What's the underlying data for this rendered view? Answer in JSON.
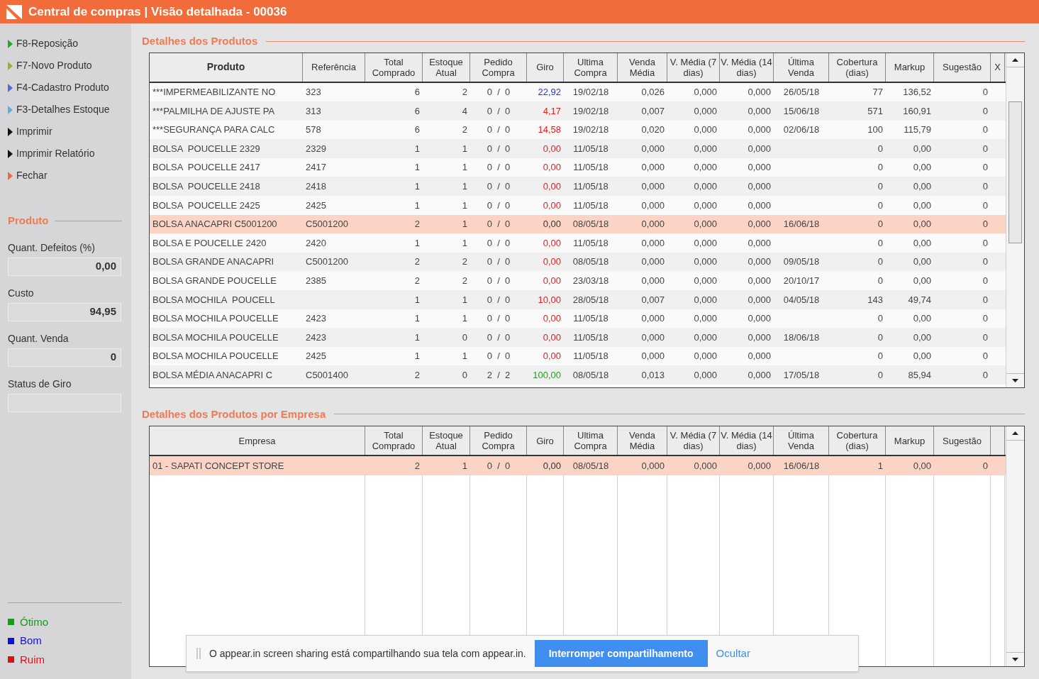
{
  "window": {
    "title": "Central de compras | Visão detalhada - 00036"
  },
  "sidebar": {
    "actions": [
      {
        "label": "F8-Reposição",
        "color": "#1fa82a"
      },
      {
        "label": "F7-Novo Produto",
        "color": "#8fb33a"
      },
      {
        "label": "F4-Cadastro Produto",
        "color": "#4a6fe0"
      },
      {
        "label": "F3-Detalhes Estoque",
        "color": "#5aaee0"
      },
      {
        "label": "Imprimir",
        "color": "#111111"
      },
      {
        "label": "Imprimir Relatório",
        "color": "#111111"
      },
      {
        "label": "Fechar",
        "color": "#f26b3a"
      }
    ],
    "section_title": "Produto",
    "fields": [
      {
        "label": "Quant. Defeitos (%)",
        "value": "0,00"
      },
      {
        "label": "Custo",
        "value": "94,95"
      },
      {
        "label": "Quant. Venda",
        "value": "0"
      },
      {
        "label": "Status de Giro"
      }
    ],
    "legend": [
      {
        "label": "Ótimo",
        "color": "#12a012"
      },
      {
        "label": "Bom",
        "color": "#1010e0"
      },
      {
        "label": "Ruim",
        "color": "#e01010"
      }
    ]
  },
  "products": {
    "title": "Detalhes dos Produtos",
    "columns": [
      "Produto",
      "Referência",
      "Total Comprado",
      "Estoque Atual",
      "Pedido Compra",
      "Giro",
      "Ultima Compra",
      "Venda Média",
      "V. Média (7 dias)",
      "V. Média (14 dias)",
      "Última Venda",
      "Cobertura (dias)",
      "Markup",
      "Sugestão",
      "X"
    ],
    "rows": [
      {
        "produto": "***IMPERMEABILIZANTE NO",
        "referencia": "323",
        "total": "6",
        "estoque": "2",
        "pedido": "0  /  0",
        "giro": "22,92",
        "color": "#2233dd",
        "ultima_compra": "19/02/18",
        "venda_media": "0,026",
        "vm7": "0,000",
        "vm14": "0,000",
        "ultima_venda": "26/05/18",
        "cobertura": "77",
        "markup": "136,52",
        "sugestao": "0",
        "selected": false
      },
      {
        "produto": "***PALMILHA DE AJUSTE PA",
        "referencia": "313",
        "total": "6",
        "estoque": "4",
        "pedido": "0  /  0",
        "giro": "4,17",
        "color": "#e02020",
        "ultima_compra": "19/02/18",
        "venda_media": "0,007",
        "vm7": "0,000",
        "vm14": "0,000",
        "ultima_venda": "15/06/18",
        "cobertura": "571",
        "markup": "160,91",
        "sugestao": "0",
        "selected": false
      },
      {
        "produto": "***SEGURANÇA PARA CALC",
        "referencia": "578",
        "total": "6",
        "estoque": "2",
        "pedido": "0  /  0",
        "giro": "14,58",
        "color": "#e02020",
        "ultima_compra": "19/02/18",
        "venda_media": "0,020",
        "vm7": "0,000",
        "vm14": "0,000",
        "ultima_venda": "02/06/18",
        "cobertura": "100",
        "markup": "115,79",
        "sugestao": "0",
        "selected": false
      },
      {
        "produto": "BOLSA  POUCELLE 2329",
        "referencia": "2329",
        "total": "1",
        "estoque": "1",
        "pedido": "0  /  0",
        "giro": "0,00",
        "color": "#e02020",
        "ultima_compra": "11/05/18",
        "venda_media": "0,000",
        "vm7": "0,000",
        "vm14": "0,000",
        "cobertura": "0",
        "markup": "0,00",
        "sugestao": "0",
        "selected": false
      },
      {
        "produto": "BOLSA  POUCELLE 2417",
        "referencia": "2417",
        "total": "1",
        "estoque": "1",
        "pedido": "0  /  0",
        "giro": "0,00",
        "color": "#e02020",
        "ultima_compra": "11/05/18",
        "venda_media": "0,000",
        "vm7": "0,000",
        "vm14": "0,000",
        "cobertura": "0",
        "markup": "0,00",
        "sugestao": "0",
        "selected": false
      },
      {
        "produto": "BOLSA  POUCELLE 2418",
        "referencia": "2418",
        "total": "1",
        "estoque": "1",
        "pedido": "0  /  0",
        "giro": "0,00",
        "color": "#e02020",
        "ultima_compra": "11/05/18",
        "venda_media": "0,000",
        "vm7": "0,000",
        "vm14": "0,000",
        "cobertura": "0",
        "markup": "0,00",
        "sugestao": "0",
        "selected": false
      },
      {
        "produto": "BOLSA  POUCELLE 2425",
        "referencia": "2425",
        "total": "1",
        "estoque": "1",
        "pedido": "0  /  0",
        "giro": "0,00",
        "color": "#e02020",
        "ultima_compra": "11/05/18",
        "venda_media": "0,000",
        "vm7": "0,000",
        "vm14": "0,000",
        "cobertura": "0",
        "markup": "0,00",
        "sugestao": "0",
        "selected": false
      },
      {
        "produto": "BOLSA ANACAPRI C5001200",
        "referencia": "C5001200",
        "total": "2",
        "estoque": "1",
        "pedido": "0  /  0",
        "giro": "0,00",
        "color": "#333333",
        "ultima_compra": "08/05/18",
        "venda_media": "0,000",
        "vm7": "0,000",
        "vm14": "0,000",
        "ultima_venda": "16/06/18",
        "cobertura": "0",
        "markup": "0,00",
        "sugestao": "0",
        "selected": true
      },
      {
        "produto": "BOLSA E POUCELLE 2420",
        "referencia": "2420",
        "total": "1",
        "estoque": "1",
        "pedido": "0  /  0",
        "giro": "0,00",
        "color": "#e02020",
        "ultima_compra": "11/05/18",
        "venda_media": "0,000",
        "vm7": "0,000",
        "vm14": "0,000",
        "cobertura": "0",
        "markup": "0,00",
        "sugestao": "0",
        "selected": false
      },
      {
        "produto": "BOLSA GRANDE ANACAPRI",
        "referencia": "C5001200",
        "total": "2",
        "estoque": "2",
        "pedido": "0  /  0",
        "giro": "0,00",
        "color": "#e02020",
        "ultima_compra": "08/05/18",
        "venda_media": "0,000",
        "vm7": "0,000",
        "vm14": "0,000",
        "ultima_venda": "09/05/18",
        "cobertura": "0",
        "markup": "0,00",
        "sugestao": "0",
        "selected": false
      },
      {
        "produto": "BOLSA GRANDE POUCELLE",
        "referencia": "2385",
        "total": "2",
        "estoque": "2",
        "pedido": "0  /  0",
        "giro": "0,00",
        "color": "#e02020",
        "ultima_compra": "23/03/18",
        "venda_media": "0,000",
        "vm7": "0,000",
        "vm14": "0,000",
        "ultima_venda": "20/10/17",
        "cobertura": "0",
        "markup": "0,00",
        "sugestao": "0",
        "selected": false
      },
      {
        "produto": "BOLSA MOCHILA  POUCELL",
        "total": "1",
        "estoque": "1",
        "pedido": "0  /  0",
        "giro": "10,00",
        "color": "#e02020",
        "ultima_compra": "28/05/18",
        "venda_media": "0,007",
        "vm7": "0,000",
        "vm14": "0,000",
        "ultima_venda": "04/05/18",
        "cobertura": "143",
        "markup": "49,74",
        "sugestao": "0",
        "selected": false
      },
      {
        "produto": "BOLSA MOCHILA POUCELLE",
        "referencia": "2423",
        "total": "1",
        "estoque": "1",
        "pedido": "0  /  0",
        "giro": "0,00",
        "color": "#e02020",
        "ultima_compra": "11/05/18",
        "venda_media": "0,000",
        "vm7": "0,000",
        "vm14": "0,000",
        "cobertura": "0",
        "markup": "0,00",
        "sugestao": "0",
        "selected": false
      },
      {
        "produto": "BOLSA MOCHILA POUCELLE",
        "referencia": "2423",
        "total": "1",
        "estoque": "0",
        "pedido": "0  /  0",
        "giro": "0,00",
        "color": "#e02020",
        "ultima_compra": "11/05/18",
        "venda_media": "0,000",
        "vm7": "0,000",
        "vm14": "0,000",
        "ultima_venda": "18/06/18",
        "cobertura": "0",
        "markup": "0,00",
        "sugestao": "0",
        "selected": false
      },
      {
        "produto": "BOLSA MOCHILA POUCELLE",
        "referencia": "2425",
        "total": "1",
        "estoque": "1",
        "pedido": "0  /  0",
        "giro": "0,00",
        "color": "#e02020",
        "ultima_compra": "11/05/18",
        "venda_media": "0,000",
        "vm7": "0,000",
        "vm14": "0,000",
        "cobertura": "0",
        "markup": "0,00",
        "sugestao": "0",
        "selected": false
      },
      {
        "produto": "BOLSA MÉDIA ANACAPRI C",
        "referencia": "C5001400",
        "total": "2",
        "estoque": "0",
        "pedido": "2  /  2",
        "giro": "100,00",
        "color": "#20a020",
        "ultima_compra": "08/05/18",
        "venda_media": "0,013",
        "vm7": "0,000",
        "vm14": "0,000",
        "ultima_venda": "17/05/18",
        "cobertura": "0",
        "markup": "85,94",
        "sugestao": "0",
        "selected": false
      }
    ]
  },
  "companies": {
    "title": "Detalhes dos Produtos por Empresa",
    "columns": [
      "Empresa",
      "Total Comprado",
      "Estoque Atual",
      "Pedido Compra",
      "Giro",
      "Ultima Compra",
      "Venda Média",
      "V. Média (7 dias)",
      "V. Média (14 dias)",
      "Última Venda",
      "Cobertura (dias)",
      "Markup",
      "Sugestão"
    ],
    "rows": [
      {
        "empresa": "01 - SAPATI CONCEPT STORE",
        "total": "2",
        "estoque": "1",
        "pedido": "0  /  0",
        "giro": "0,00",
        "color": "#333333",
        "ultima_compra": "08/05/18",
        "venda_media": "0,000",
        "vm7": "0,000",
        "vm14": "0,000",
        "ultima_venda": "16/06/18",
        "cobertura": "1",
        "markup": "0,00",
        "sugestao": "0",
        "selected": true
      }
    ]
  },
  "notice": {
    "text": "O appear.in screen sharing está compartilhando sua tela com appear.in.",
    "button": "Interromper compartilhamento",
    "link": "Ocultar"
  }
}
